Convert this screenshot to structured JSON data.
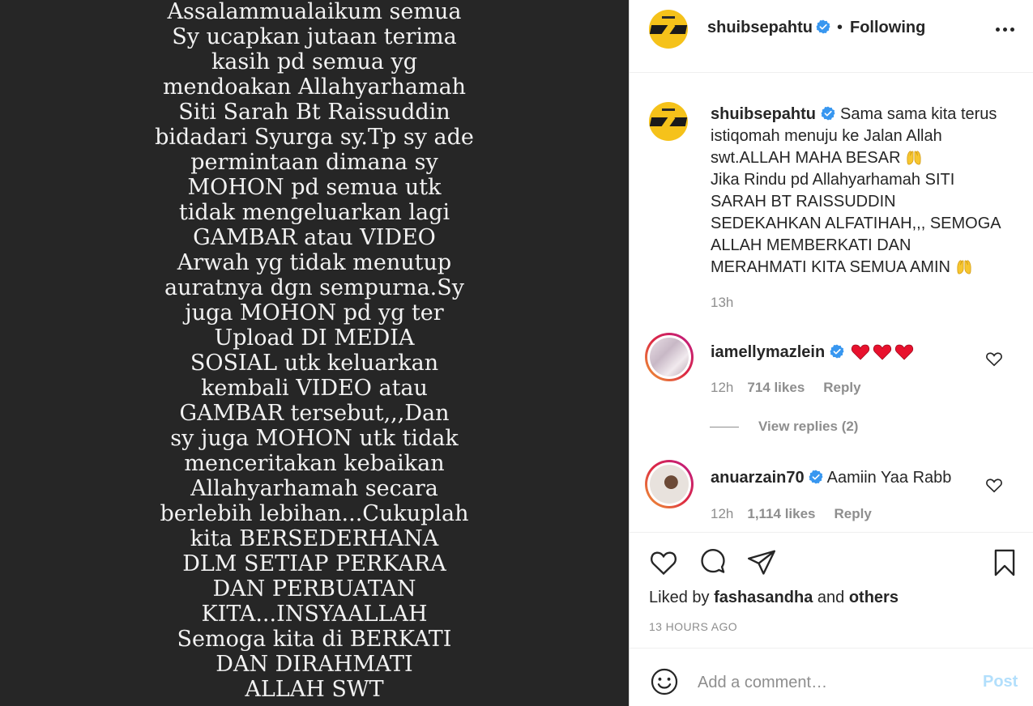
{
  "media": {
    "lines": [
      "Assalammualaikum semua",
      "Sy ucapkan jutaan terima",
      "kasih pd semua yg",
      "mendoakan Allahyarhamah",
      "Siti Sarah Bt Raissuddin",
      "bidadari Syurga sy.Tp sy ade",
      "permintaan dimana sy",
      "MOHON pd semua utk",
      "tidak mengeluarkan lagi",
      "GAMBAR atau VIDEO",
      "Arwah yg tidak menutup",
      "auratnya dgn sempurna.Sy",
      "juga MOHON pd yg ter",
      "Upload DI MEDIA",
      "SOSIAL utk keluarkan",
      "kembali VIDEO atau",
      "GAMBAR tersebut,,,Dan",
      "sy juga MOHON utk tidak",
      "menceritakan kebaikan",
      "Allahyarhamah secara",
      "berlebih lebihan...Cukuplah",
      "kita BERSEDERHANA",
      "DLM SETIAP PERKARA",
      "DAN PERBUATAN",
      "KITA...INSYAALLAH",
      "Semoga kita di BERKATI",
      "DAN DIRAHMATI",
      "ALLAH SWT"
    ]
  },
  "header": {
    "username": "shuibsepahtu",
    "separator": "•",
    "follow_status": "Following",
    "more_icon": "more-horizontal-icon"
  },
  "caption": {
    "username": "shuibsepahtu",
    "text_part1": "Sama sama kita terus istiqomah menuju ke Jalan Allah swt.ALLAH MAHA BESAR",
    "text_part2": "Jika Rindu pd Allahyarhamah SITI SARAH BT RAISSUDDIN SEDEKAHKAN ALFATIHAH,,, SEMOGA ALLAH MEMBERKATI DAN MERAHMATI KITA SEMUA AMIN",
    "time": "13h"
  },
  "comments": [
    {
      "username": "iamellymazlein",
      "text": "",
      "emoji": "red-heart-icon",
      "time": "12h",
      "likes": "714 likes",
      "reply": "Reply",
      "view_replies": "View replies (2)"
    },
    {
      "username": "anuarzain70",
      "text": "Aamiin Yaa Rabb",
      "time": "12h",
      "likes": "1,114 likes",
      "reply": "Reply"
    }
  ],
  "actions": {
    "liked_by_prefix": "Liked by",
    "liked_by_user": "fashasandha",
    "liked_by_and": "and",
    "liked_by_others": "others",
    "post_time": "13 HOURS AGO"
  },
  "add_comment": {
    "placeholder": "Add a comment…",
    "post_label": "Post"
  },
  "colors": {
    "verified": "#3897f0",
    "post_button": "#b2dffc",
    "media_bg": "#262626"
  }
}
